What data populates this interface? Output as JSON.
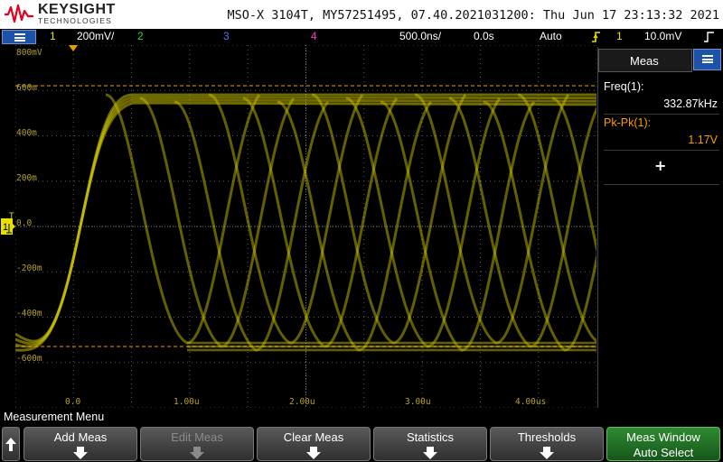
{
  "header": {
    "brand": "KEYSIGHT",
    "brand_sub": "TECHNOLOGIES",
    "instrument_info": "MSO-X 3104T, MY57251495, 07.40.2021031200: Thu Jun 17 23:13:32 2021"
  },
  "status_bar": {
    "ch1_num": "1",
    "ch1_scale": "200mV/",
    "ch2_num": "2",
    "ch3_num": "3",
    "ch4_num": "4",
    "timebase": "500.0ns/",
    "delay": "0.0s",
    "trigger_mode": "Auto",
    "trigger_source": "1",
    "trigger_level": "10.0mV"
  },
  "graticule": {
    "y_labels": [
      "800mV",
      "600m",
      "400m",
      "200m",
      "0.0",
      "-200m",
      "-400m",
      "-600m"
    ],
    "x_labels": [
      "0.0",
      "1.00u",
      "2.00u",
      "3.00u",
      "4.00us"
    ],
    "gnd_label": "1"
  },
  "meas_panel": {
    "title": "Meas",
    "freq_label": "Freq(1):",
    "freq_value": "332.87kHz",
    "pkpk_label": "Pk-Pk(1):",
    "pkpk_value": "1.17V",
    "add_symbol": "+"
  },
  "menu": {
    "title": "Measurement Menu",
    "softkeys": [
      {
        "label": "Add Meas"
      },
      {
        "label": "Edit Meas"
      },
      {
        "label": "Clear Meas"
      },
      {
        "label": "Statistics"
      },
      {
        "label": "Thresholds"
      }
    ],
    "meas_window": {
      "line1": "Meas Window",
      "line2": "Auto Select"
    }
  },
  "colors": {
    "ch1": "#e8e000",
    "ch2": "#3fce3f",
    "ch3": "#5b6cff",
    "ch4": "#ff3cc7",
    "trace": "#c8c000",
    "cursor": "#e8a000",
    "accent_blue": "#1c52a8",
    "meas_orange": "#ff9c00"
  },
  "icons": {
    "menu": "menu-lines-icon",
    "trigger": "trigger-edge-icon",
    "meas_tab": "meas-lines-icon",
    "softkey_arrow": "down-arrow-icon",
    "scroll_up": "up-arrow-icon"
  }
}
